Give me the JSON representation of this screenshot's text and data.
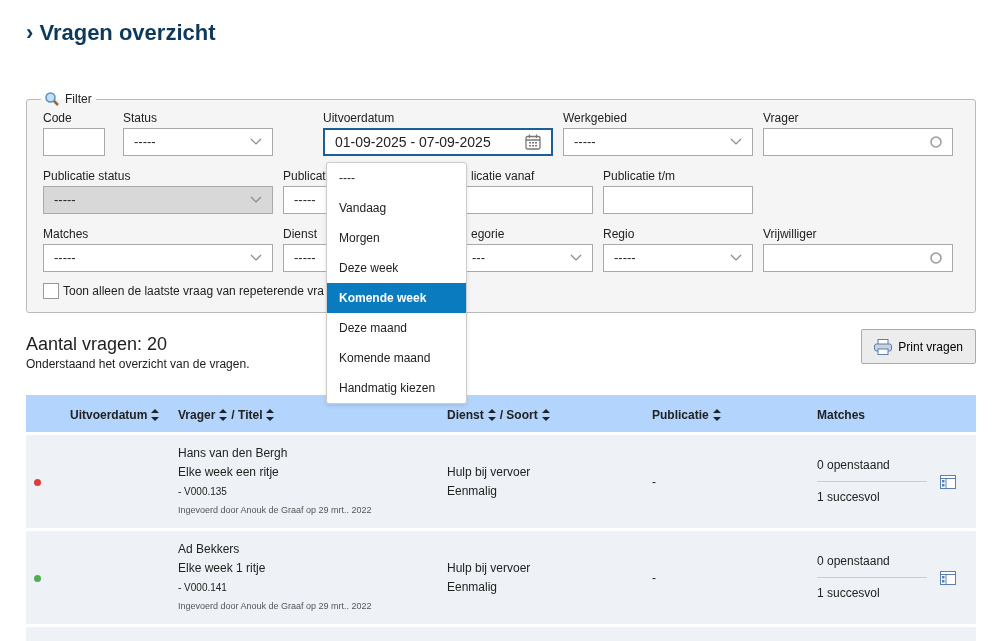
{
  "title": "› Vragen overzicht",
  "filter": {
    "legend": "Filter",
    "rows": [
      [
        {
          "label": "Code",
          "kind": "text"
        },
        {
          "label": "Status",
          "kind": "select",
          "value": "-----"
        },
        {
          "label": "Uitvoerdatum",
          "kind": "date",
          "value": "01-09-2025 - 07-09-2025",
          "focused": true
        },
        {
          "label": "Werkgebied",
          "kind": "select",
          "value": "-----"
        },
        {
          "label": "Vrager",
          "kind": "lookup"
        }
      ],
      [
        {
          "label": "Publicatie status",
          "kind": "select",
          "value": "-----",
          "disabled": true
        },
        {
          "label": "Publicat",
          "kind": "plainselect",
          "value": "-----"
        },
        {
          "label": "licatie vanaf",
          "kind": "text",
          "covered": true
        },
        {
          "label": "Publicatie t/m",
          "kind": "text"
        }
      ],
      [
        {
          "label": "Matches",
          "kind": "select",
          "value": "-----"
        },
        {
          "label": "Dienst",
          "kind": "plainselect",
          "value": "-----"
        },
        {
          "label": "egorie",
          "kind": "select",
          "value": "---",
          "covered": true
        },
        {
          "label": "Regio",
          "kind": "select",
          "value": "-----"
        },
        {
          "label": "Vrijwilliger",
          "kind": "lookup"
        }
      ]
    ],
    "checkbox": {
      "label": "Toon alleen de laatste vraag van repeterende vra",
      "checked": false
    }
  },
  "date_dropdown": {
    "options": [
      {
        "label": "----",
        "selected": false
      },
      {
        "label": "Vandaag",
        "selected": false
      },
      {
        "label": "Morgen",
        "selected": false
      },
      {
        "label": "Deze week",
        "selected": false
      },
      {
        "label": "Komende week",
        "selected": true
      },
      {
        "label": "Deze maand",
        "selected": false
      },
      {
        "label": "Komende maand",
        "selected": false
      },
      {
        "label": "Handmatig kiezen",
        "selected": false
      }
    ]
  },
  "count_title": "Aantal vragen: 20",
  "subtitle": "Onderstaand het overzicht van de vragen.",
  "print_button": "Print vragen",
  "table": {
    "columns": [
      [
        {
          "label": "Uitvoerdatum",
          "sortable": true
        }
      ],
      [
        {
          "label": "Vrager",
          "sortable": true
        },
        {
          "label": "/ Titel",
          "sortable": true
        }
      ],
      [
        {
          "label": "Dienst",
          "sortable": true
        },
        {
          "label": "/ Soort",
          "sortable": true
        }
      ],
      [
        {
          "label": "Publicatie",
          "sortable": true
        }
      ],
      [
        {
          "label": "Matches",
          "sortable": false
        }
      ]
    ],
    "rows": [
      {
        "color": "#e03c3c",
        "requester": "Hans van den Bergh",
        "title": "Elke week een ritje",
        "code": "- V000.135",
        "entered": "Ingevoerd door Anouk de Graaf op 29 mrt.. 2022",
        "service": "Hulp bij vervoer",
        "type": "Eenmalig",
        "publication": "-",
        "open": "0 openstaand",
        "success": "1 succesvol"
      },
      {
        "color": "#4caf50",
        "requester": "Ad Bekkers",
        "title": "Elke week 1 ritje",
        "code": "- V000.141",
        "entered": "Ingevoerd door Anouk de Graaf op 29 mrt.. 2022",
        "service": "Hulp bij vervoer",
        "type": "Eenmalig",
        "publication": "-",
        "open": "0 openstaand",
        "success": "1 succesvol"
      }
    ]
  }
}
